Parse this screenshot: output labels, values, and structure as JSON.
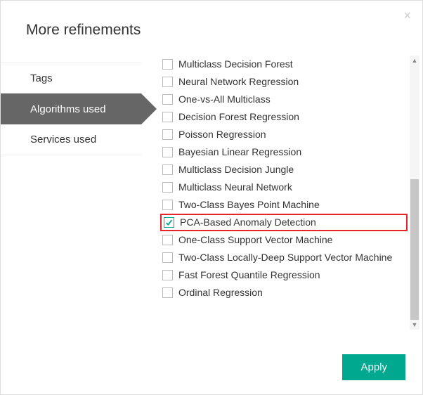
{
  "dialog": {
    "title": "More refinements",
    "close_char": "×",
    "apply_label": "Apply"
  },
  "tabs": [
    {
      "label": "Tags",
      "active": false
    },
    {
      "label": "Algorithms used",
      "active": true
    },
    {
      "label": "Services used",
      "active": false
    }
  ],
  "items": [
    {
      "label": "Multiclass Decision Forest",
      "checked": false,
      "highlight": false
    },
    {
      "label": "Neural Network Regression",
      "checked": false,
      "highlight": false
    },
    {
      "label": "One-vs-All Multiclass",
      "checked": false,
      "highlight": false
    },
    {
      "label": "Decision Forest Regression",
      "checked": false,
      "highlight": false
    },
    {
      "label": "Poisson Regression",
      "checked": false,
      "highlight": false
    },
    {
      "label": "Bayesian Linear Regression",
      "checked": false,
      "highlight": false
    },
    {
      "label": "Multiclass Decision Jungle",
      "checked": false,
      "highlight": false
    },
    {
      "label": "Multiclass Neural Network",
      "checked": false,
      "highlight": false
    },
    {
      "label": "Two-Class Bayes Point Machine",
      "checked": false,
      "highlight": false
    },
    {
      "label": "PCA-Based Anomaly Detection",
      "checked": true,
      "highlight": true
    },
    {
      "label": "One-Class Support Vector Machine",
      "checked": false,
      "highlight": false
    },
    {
      "label": "Two-Class Locally-Deep Support Vector Machine",
      "checked": false,
      "highlight": false
    },
    {
      "label": "Fast Forest Quantile Regression",
      "checked": false,
      "highlight": false
    },
    {
      "label": "Ordinal Regression",
      "checked": false,
      "highlight": false
    }
  ],
  "colors": {
    "accent": "#00A88F",
    "active_tab_bg": "#666666",
    "highlight_border": "#E6252A"
  }
}
